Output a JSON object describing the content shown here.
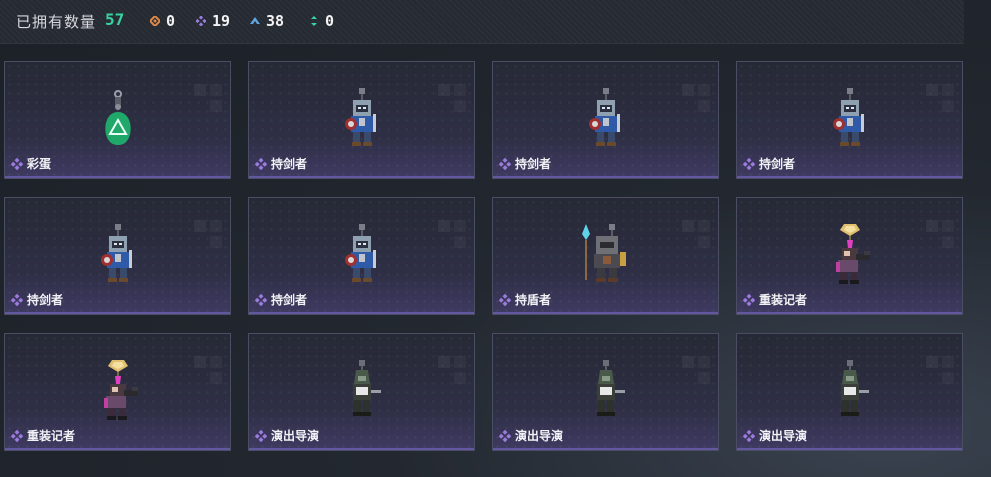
{
  "header": {
    "owned_label": "已拥有数量",
    "owned_count": "57",
    "stats": [
      {
        "icon": "orange-diamond-icon",
        "color": "#e0894a",
        "value": "0"
      },
      {
        "icon": "purple-diamond-icon",
        "color": "#9b7be0",
        "value": "19"
      },
      {
        "icon": "blue-arrow-icon",
        "color": "#5fa6e0",
        "value": "38"
      },
      {
        "icon": "green-arrows-icon",
        "color": "#35d4a0",
        "value": "0"
      }
    ]
  },
  "cards": [
    {
      "name": "彩蛋",
      "art": "egg"
    },
    {
      "name": "持剑者",
      "art": "knight"
    },
    {
      "name": "持剑者",
      "art": "knight"
    },
    {
      "name": "持剑者",
      "art": "knight"
    },
    {
      "name": "持剑者",
      "art": "knight"
    },
    {
      "name": "持剑者",
      "art": "knight"
    },
    {
      "name": "持盾者",
      "art": "shield"
    },
    {
      "name": "重装记者",
      "art": "reporter"
    },
    {
      "name": "重装记者",
      "art": "reporter"
    },
    {
      "name": "演出导演",
      "art": "director"
    },
    {
      "name": "演出导演",
      "art": "director"
    },
    {
      "name": "演出导演",
      "art": "director"
    }
  ]
}
